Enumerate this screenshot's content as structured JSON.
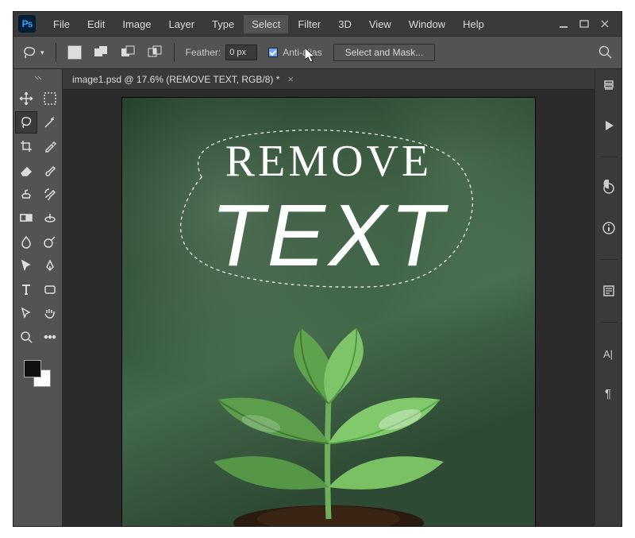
{
  "app": {
    "logo_text": "Ps"
  },
  "menu": {
    "items": [
      "File",
      "Edit",
      "Image",
      "Layer",
      "Type",
      "Select",
      "Filter",
      "3D",
      "View",
      "Window",
      "Help"
    ],
    "highlighted_index": 5
  },
  "options_bar": {
    "feather_label": "Feather:",
    "feather_value": "0 px",
    "antialias_label": "Anti-alias",
    "select_mask_label": "Select and Mask..."
  },
  "document": {
    "tab_title": "image1.psd @ 17.6% (REMOVE TEXT, RGB/8) *",
    "headline": "REMOVE",
    "subline": "TEXT"
  },
  "tools": {
    "left": [
      "move-tool",
      "marquee-tool",
      "lasso-tool",
      "magic-wand-tool",
      "crop-tool",
      "eyedropper-tool",
      "eraser-tool",
      "brush-tool",
      "clone-stamp-tool",
      "history-brush-tool",
      "gradient-tool",
      "paint-bucket-tool",
      "blur-tool",
      "dodge-tool",
      "path-selection-tool",
      "pen-tool",
      "type-tool",
      "shape-tool",
      "direct-selection-tool",
      "hand-tool",
      "zoom-tool",
      "edit-toolbar"
    ],
    "selected_index": 2
  },
  "right_dock": {
    "icons": [
      "history-panel-icon",
      "play-icon",
      "adjustments-panel-icon",
      "info-panel-icon",
      "paragraph-panel-icon",
      "character-panel-icon",
      "pilcrow-icon"
    ]
  }
}
